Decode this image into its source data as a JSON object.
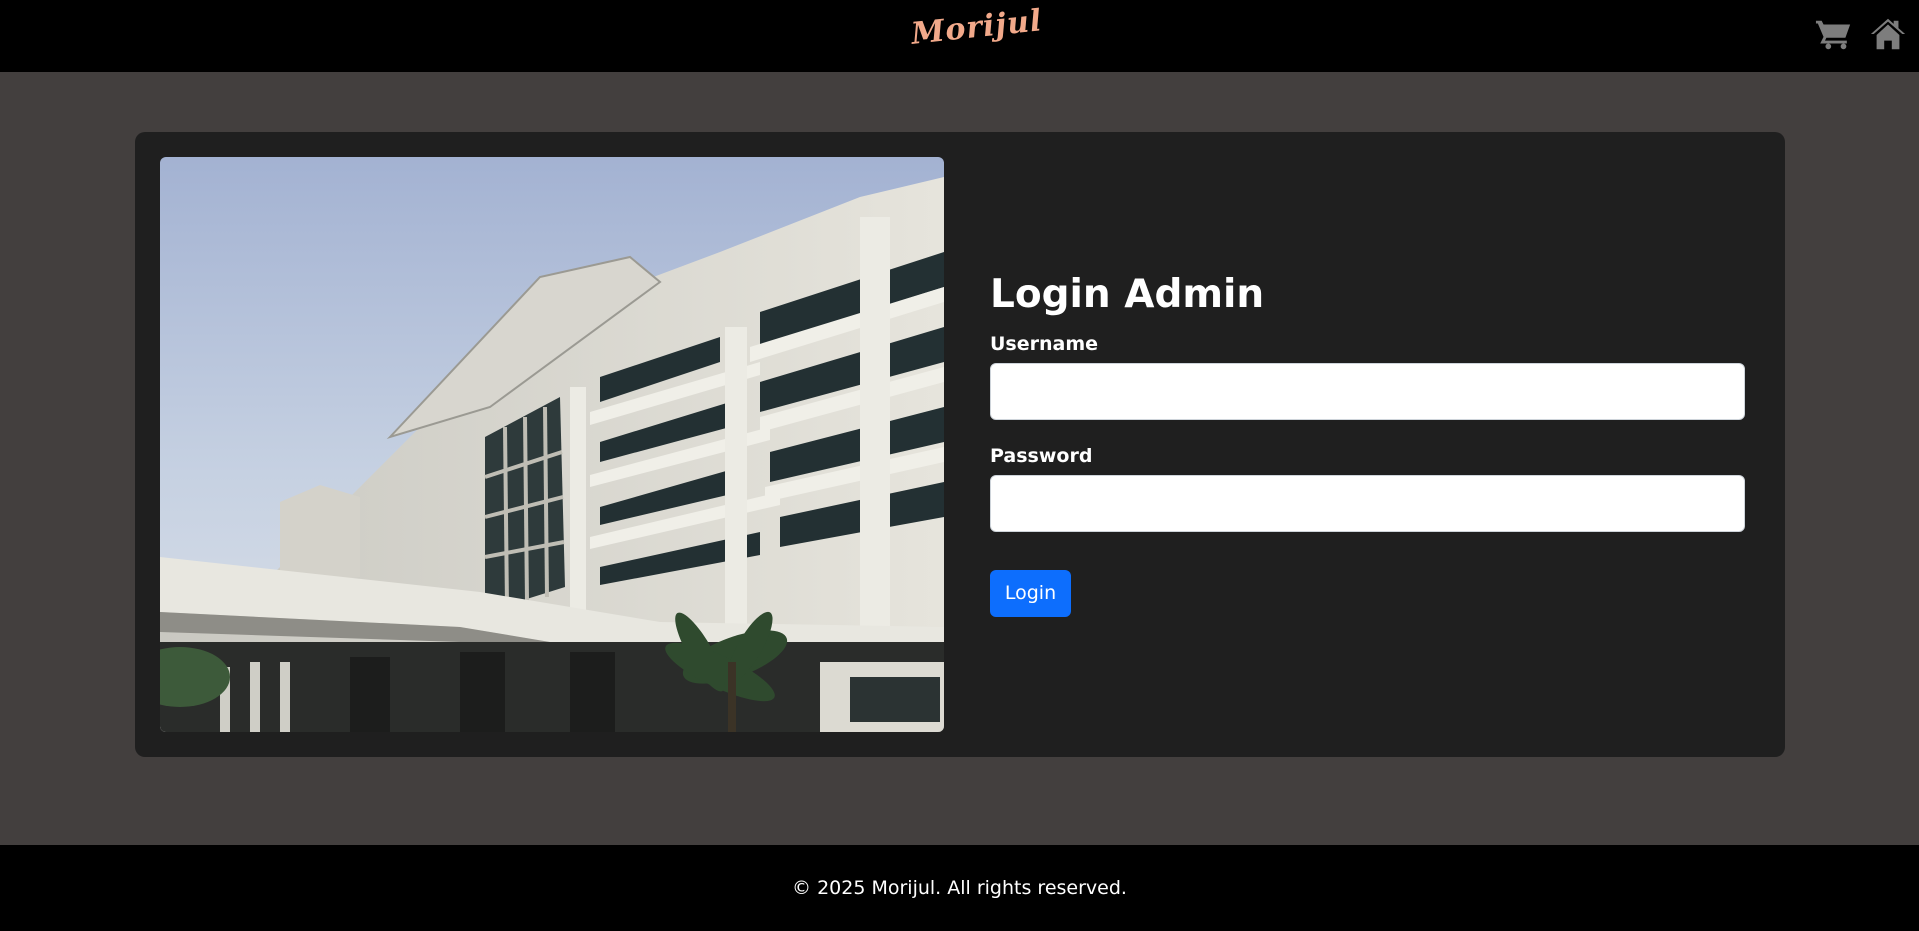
{
  "header": {
    "brand": "Morijul",
    "brand_color": "#f2a98a",
    "icons": [
      "cart-icon",
      "home-icon"
    ]
  },
  "login": {
    "title": "Login Admin",
    "username_label": "Username",
    "username_value": "",
    "password_label": "Password",
    "password_value": "",
    "submit_label": "Login",
    "submit_color": "#0d6efd"
  },
  "footer": {
    "text": "© 2025 Morijul. All rights reserved."
  }
}
